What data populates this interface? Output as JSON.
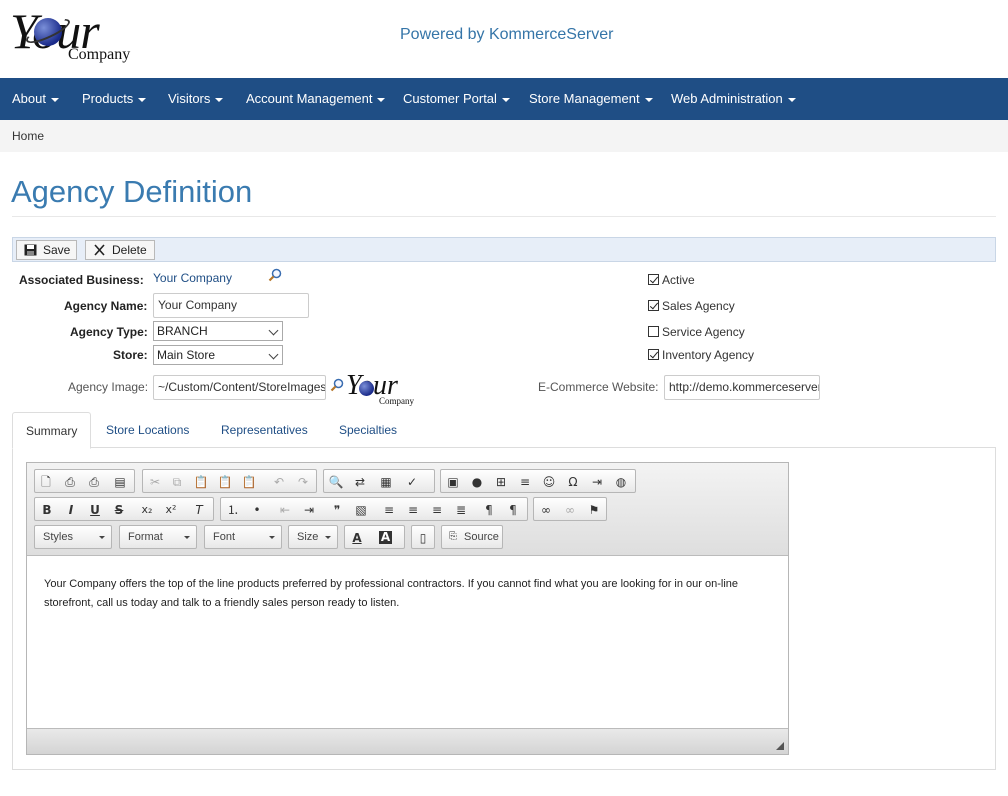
{
  "header": {
    "logo_your": "Your",
    "logo_company": "Company",
    "powered_by": "Powered by KommerceServer"
  },
  "nav": {
    "items": [
      {
        "label": "About"
      },
      {
        "label": "Products"
      },
      {
        "label": "Visitors"
      },
      {
        "label": "Account Management"
      },
      {
        "label": "Customer Portal"
      },
      {
        "label": "Store Management"
      },
      {
        "label": "Web Administration"
      }
    ]
  },
  "breadcrumb": {
    "home": "Home"
  },
  "page": {
    "title": "Agency Definition"
  },
  "toolbar": {
    "save_label": "Save",
    "delete_label": "Delete"
  },
  "form": {
    "associated_business_label": "Associated Business:",
    "associated_business_value": "Your Company",
    "agency_name_label": "Agency Name:",
    "agency_name_value": "Your Company",
    "agency_type_label": "Agency Type:",
    "agency_type_value": "BRANCH",
    "store_label": "Store:",
    "store_value": "Main Store",
    "agency_image_label": "Agency Image:",
    "agency_image_value": "~/Custom/Content/StoreImages",
    "ecommerce_label": "E-Commerce Website:",
    "ecommerce_value": "http://demo.kommerceserver",
    "checkboxes": [
      {
        "label": "Active",
        "checked": true
      },
      {
        "label": "Sales Agency",
        "checked": true
      },
      {
        "label": "Service Agency",
        "checked": false
      },
      {
        "label": "Inventory Agency",
        "checked": true
      }
    ]
  },
  "tabs": [
    {
      "label": "Summary",
      "active": true
    },
    {
      "label": "Store Locations"
    },
    {
      "label": "Representatives"
    },
    {
      "label": "Specialties"
    }
  ],
  "editor": {
    "combos": {
      "styles": "Styles",
      "format": "Format",
      "font": "Font",
      "size": "Size"
    },
    "source_label": "Source",
    "content": "Your Company offers the top of the line products preferred by professional contractors. If you cannot find what you are looking for in our on-line storefront, call us today and talk to a friendly sales person ready to listen."
  }
}
